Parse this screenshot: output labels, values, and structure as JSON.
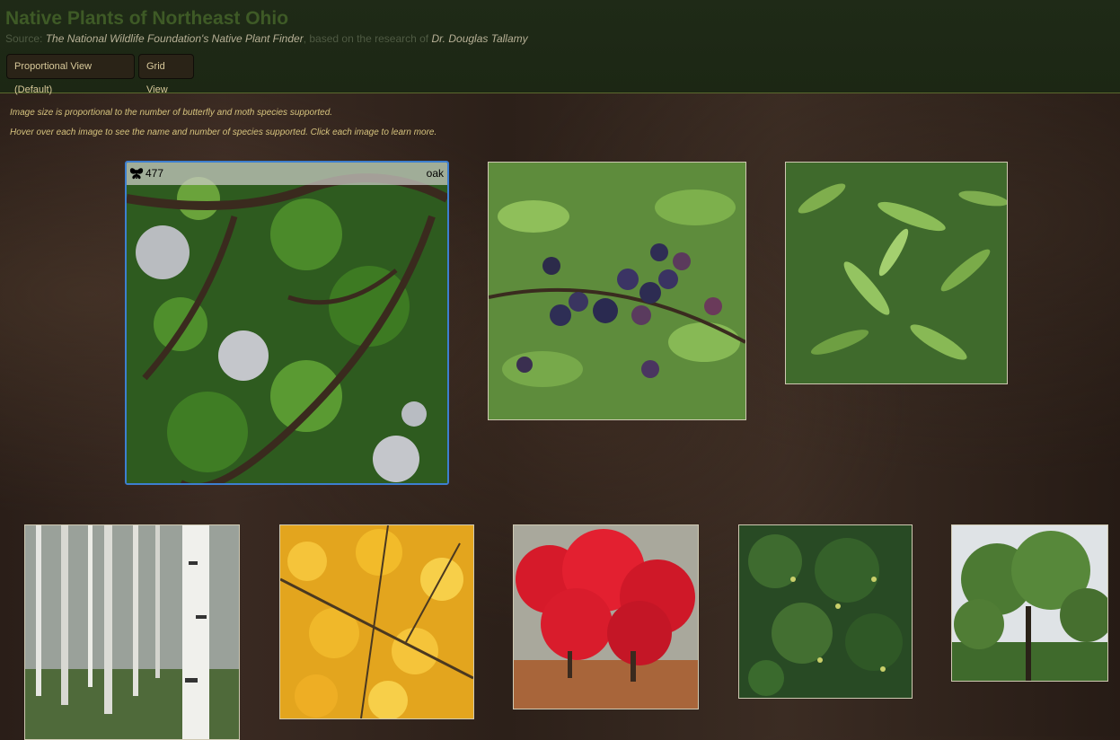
{
  "header": {
    "title": "Native Plants of Northeast Ohio",
    "source_prefix": "Source: ",
    "source_name": "The National Wildlife Foundation's Native Plant Finder",
    "source_middle": ", based on the research of ",
    "source_author": "Dr. Douglas Tallamy"
  },
  "views": {
    "proportional_label": "Proportional View (Default)",
    "grid_label": "Grid View"
  },
  "info": {
    "line1": "Image size is proportional to the number of butterfly and moth species supported.",
    "line2": "Hover over each image to see the name and number of species supported. Click each image to learn more."
  },
  "plants": [
    {
      "name": "oak",
      "species": "477",
      "icon": "butterfly-icon",
      "hovered": true
    }
  ],
  "colors": {
    "title": "#3e5a26",
    "accent": "#d6c37e",
    "hover_border": "#3d7fd0"
  }
}
